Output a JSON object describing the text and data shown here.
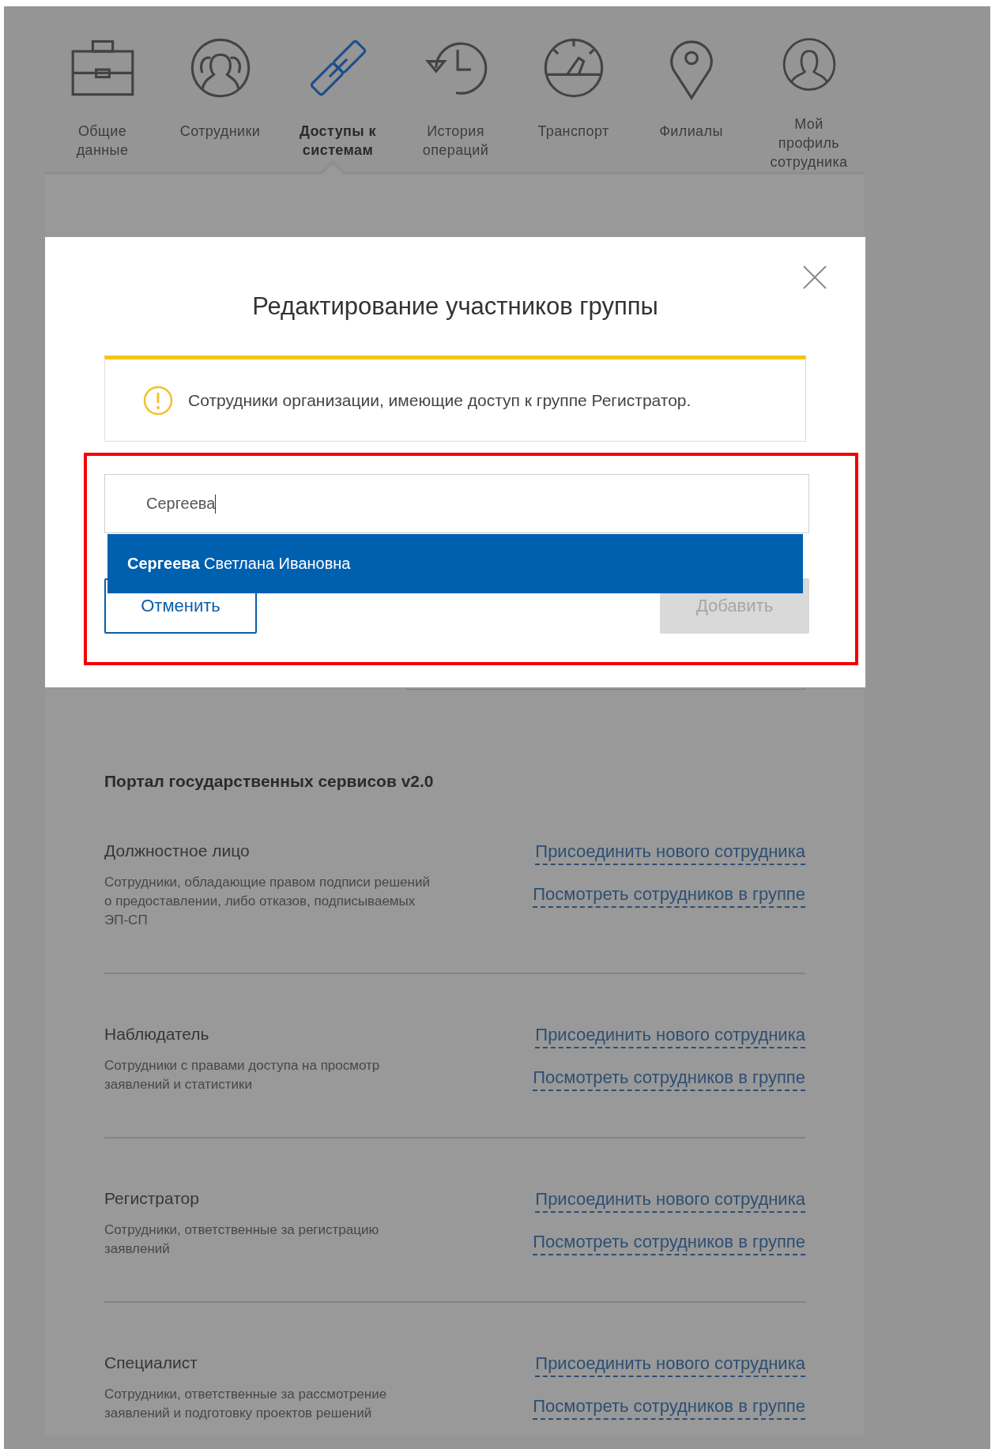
{
  "nav": {
    "items": [
      {
        "label": "Общие данные",
        "selected": false
      },
      {
        "label": "Сотрудники",
        "selected": false
      },
      {
        "label": "Доступы к системам",
        "selected": true
      },
      {
        "label": "История операций",
        "selected": false
      },
      {
        "label": "Транспорт",
        "selected": false
      },
      {
        "label": "Филиалы",
        "selected": false
      },
      {
        "label": "Мой профиль сотрудника",
        "selected": false
      }
    ]
  },
  "portal": {
    "title": "Портал государственных сервисов v2.0",
    "groups": [
      {
        "name": "Должностное лицо",
        "description": "Сотрудники, обладающие правом подписи решений о предоставлении, либо отказов, подписываемых ЭП-СП",
        "links": [
          "Присоединить нового сотрудника",
          "Посмотреть сотрудников в группе"
        ]
      },
      {
        "name": "Наблюдатель",
        "description": "Сотрудники с правами доступа на просмотр заявлений и статистики",
        "links": [
          "Присоединить нового сотрудника",
          "Посмотреть сотрудников в группе"
        ]
      },
      {
        "name": "Регистратор",
        "description": "Сотрудники, ответственные за регистрацию заявлений",
        "links": [
          "Присоединить нового сотрудника",
          "Посмотреть сотрудников в группе"
        ]
      },
      {
        "name": "Специалист",
        "description": "Сотрудники, ответственные за рассмотрение заявлений и подготовку проектов решений",
        "links": [
          "Присоединить нового сотрудника",
          "Посмотреть сотрудников в группе"
        ]
      }
    ]
  },
  "modal": {
    "title": "Редактирование участников группы",
    "alert": "Сотрудники организации, имеющие доступ к группе Регистратор.",
    "search": {
      "value": "Сергеева"
    },
    "suggestions": [
      {
        "text": "**Сергеева** Светлана Ивановна",
        "selected": true
      }
    ],
    "buttons": [
      {
        "label": "Отменить",
        "kind": "secondary",
        "disabled": false
      },
      {
        "label": "Добавить",
        "kind": "primary",
        "disabled": true
      }
    ]
  }
}
